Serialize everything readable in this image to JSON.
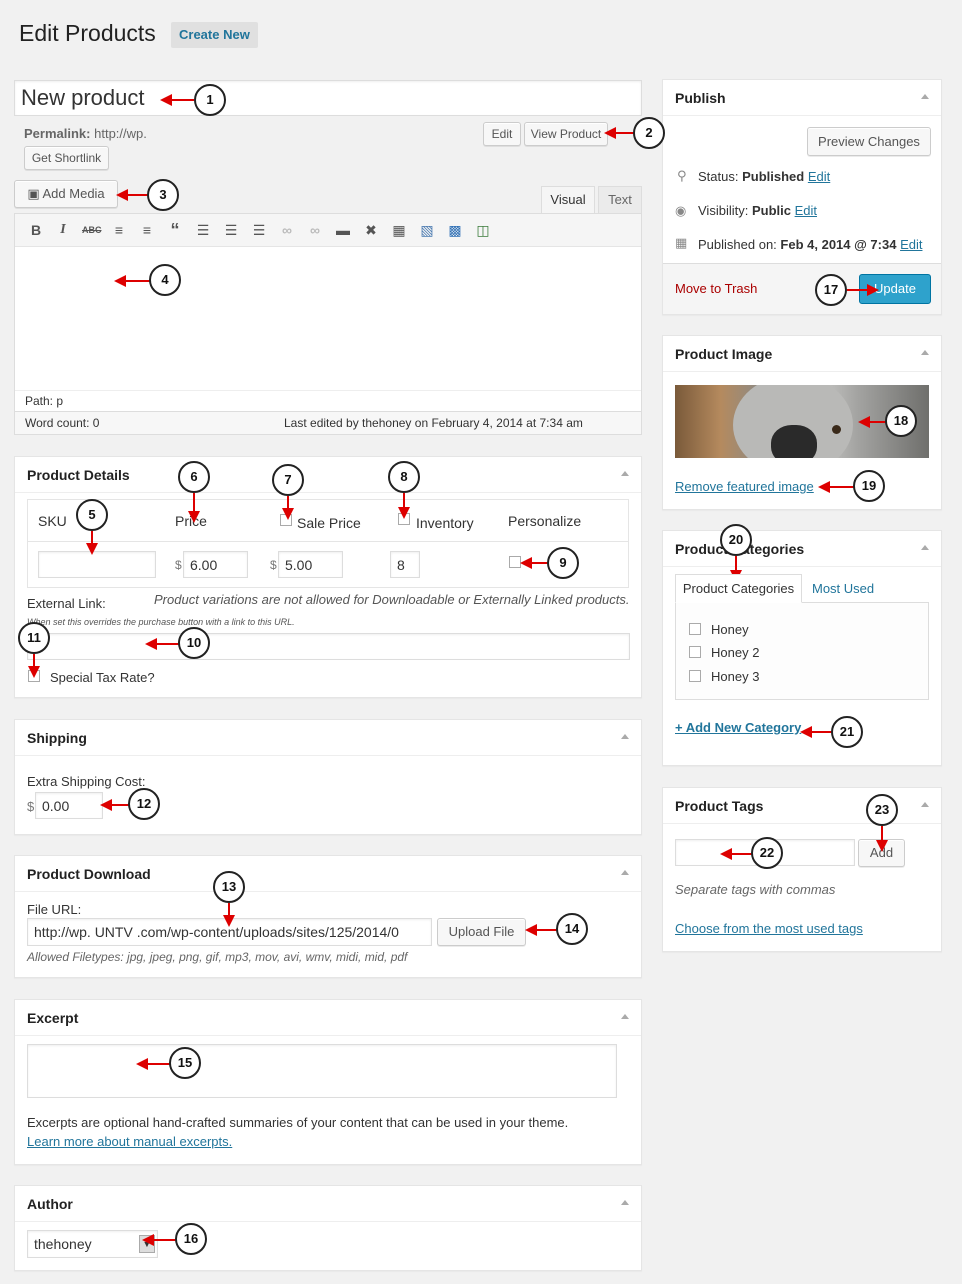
{
  "header": {
    "title": "Edit Products",
    "create_new": "Create New"
  },
  "title_box": {
    "value": "New product"
  },
  "permalink": {
    "label": "Permalink:",
    "url": "http://wp.",
    "edit_btn": "Edit",
    "view_btn": "View Product",
    "shortlink_btn": "Get Shortlink"
  },
  "editor": {
    "add_media": "Add Media",
    "tab_visual": "Visual",
    "tab_text": "Text",
    "toolbar": [
      "bold-icon",
      "italic-icon",
      "strikethrough-icon",
      "bullet-list-icon",
      "numbered-list-icon",
      "blockquote-icon",
      "align-left-icon",
      "align-center-icon",
      "align-right-icon",
      "link-icon",
      "unlink-icon",
      "more-tag-icon",
      "fullscreen-icon",
      "toolbar-toggle-icon",
      "image-icon",
      "gallery-icon",
      "video-icon"
    ],
    "path": "Path: p",
    "word_count": "Word count: 0",
    "last_edited": "Last edited by thehoney on February 4, 2014 at 7:34 am"
  },
  "product_details": {
    "title": "Product Details",
    "headers": {
      "sku": "SKU",
      "price": "Price",
      "sale_price": "Sale Price",
      "inventory": "Inventory",
      "personalize": "Personalize"
    },
    "currency": "$",
    "price": "6.00",
    "sale_price": "5.00",
    "inventory": "8",
    "sku": "",
    "variations_note": "Product variations are not allowed for Downloadable or Externally Linked products.",
    "external_link_label": "External Link:",
    "external_link_note": "When set this overrides the purchase button with a link to this URL.",
    "special_tax": "Special Tax Rate?"
  },
  "shipping": {
    "title": "Shipping",
    "label": "Extra Shipping Cost:",
    "currency": "$",
    "value": "0.00"
  },
  "download": {
    "title": "Product Download",
    "file_label": "File URL:",
    "file_value": "http://wp.  UNTV  .com/wp-content/uploads/sites/125/2014/0",
    "upload_btn": "Upload File",
    "allowed": "Allowed Filetypes: jpg, jpeg, png, gif, mp3, mov, avi, wmv, midi, mid, pdf"
  },
  "excerpt": {
    "title": "Excerpt",
    "note": "Excerpts are optional hand-crafted summaries of your content that can be used in your theme.",
    "link": "Learn more about manual excerpts."
  },
  "author": {
    "title": "Author",
    "value": "thehoney"
  },
  "publish": {
    "title": "Publish",
    "preview_btn": "Preview Changes",
    "status_label": "Status:",
    "status_value": "Published",
    "visibility_label": "Visibility:",
    "visibility_value": "Public",
    "published_label": "Published on:",
    "published_value": "Feb 4, 2014 @ 7:34",
    "edit": "Edit",
    "trash": "Move to Trash",
    "update_btn": "Update"
  },
  "product_image": {
    "title": "Product Image",
    "remove": "Remove featured image"
  },
  "categories": {
    "title": "Product Categories",
    "tab_all": "Product Categories",
    "tab_used": "Most Used",
    "items": [
      "Honey",
      "Honey 2",
      "Honey 3"
    ],
    "add_new": "+ Add New Category"
  },
  "tags": {
    "title": "Product Tags",
    "add_btn": "Add",
    "note": "Separate tags with commas",
    "choose": "Choose from the most used tags"
  },
  "callouts": [
    "1",
    "2",
    "3",
    "4",
    "5",
    "6",
    "7",
    "8",
    "9",
    "10",
    "11",
    "12",
    "13",
    "14",
    "15",
    "16",
    "17",
    "18",
    "19",
    "20",
    "21",
    "22",
    "23"
  ],
  "colors": {
    "accent": "#21759b",
    "update": "#2ea2cc",
    "trash": "#a00",
    "arrow": "#d00"
  }
}
